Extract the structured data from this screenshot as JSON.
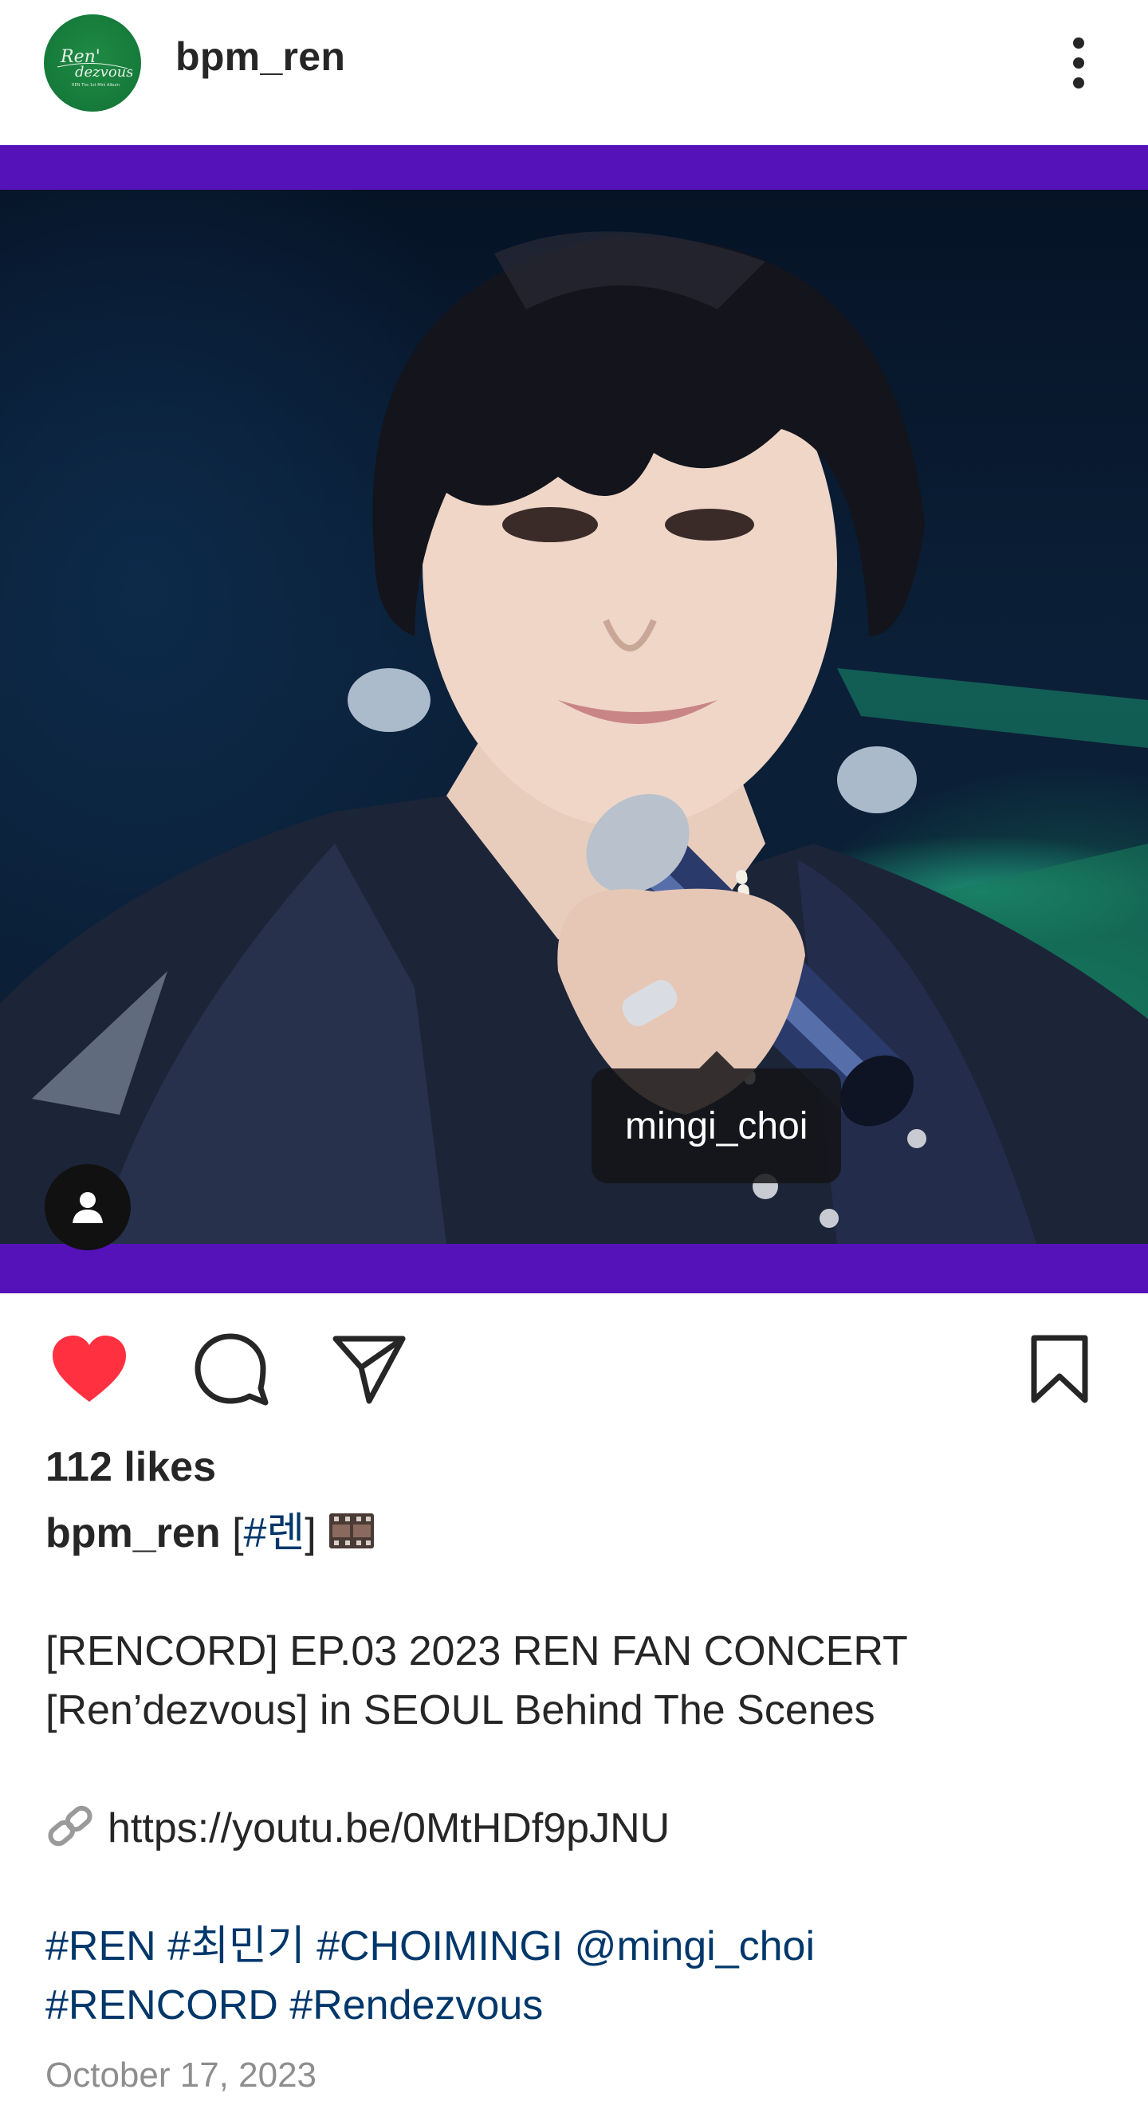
{
  "header": {
    "username": "bpm_ren",
    "avatar_text": "Ren' dezvous"
  },
  "media": {
    "tag_label": "mingi_choi"
  },
  "actions": {
    "liked": true
  },
  "post": {
    "likes": "112 likes",
    "caption_user": "bpm_ren",
    "caption_tag_open": "[",
    "caption_tag": "#렌",
    "caption_tag_close": "]",
    "caption_line1": "[RENCORD] EP.03 2023 REN FAN CONCERT",
    "caption_line2": "[Ren’dezvous] in SEOUL Behind The Scenes",
    "link": "https://youtu.be/0MtHDf9pJNU",
    "hashtags_line1": [
      {
        "text": "#REN",
        "kind": "hashtag"
      },
      {
        "text": "#최민기",
        "kind": "hashtag"
      },
      {
        "text": "#CHOIMINGI",
        "kind": "hashtag"
      },
      {
        "text": "@mingi_choi",
        "kind": "mention"
      }
    ],
    "hashtags_line2": [
      {
        "text": "#RENCORD",
        "kind": "hashtag"
      },
      {
        "text": "#Rendezvous",
        "kind": "hashtag"
      }
    ],
    "date": "October 17, 2023"
  },
  "colors": {
    "media_border": "#5512b8",
    "heart": "#ff3040",
    "link_blue": "#00376b",
    "avatar_green": "#157a3a"
  },
  "icons": {
    "more": "more-vertical-icon",
    "like": "heart-filled-icon",
    "comment": "comment-icon",
    "share": "paper-plane-icon",
    "save": "bookmark-icon",
    "user_tag": "person-icon",
    "film": "film-frames-icon",
    "link": "link-icon"
  }
}
